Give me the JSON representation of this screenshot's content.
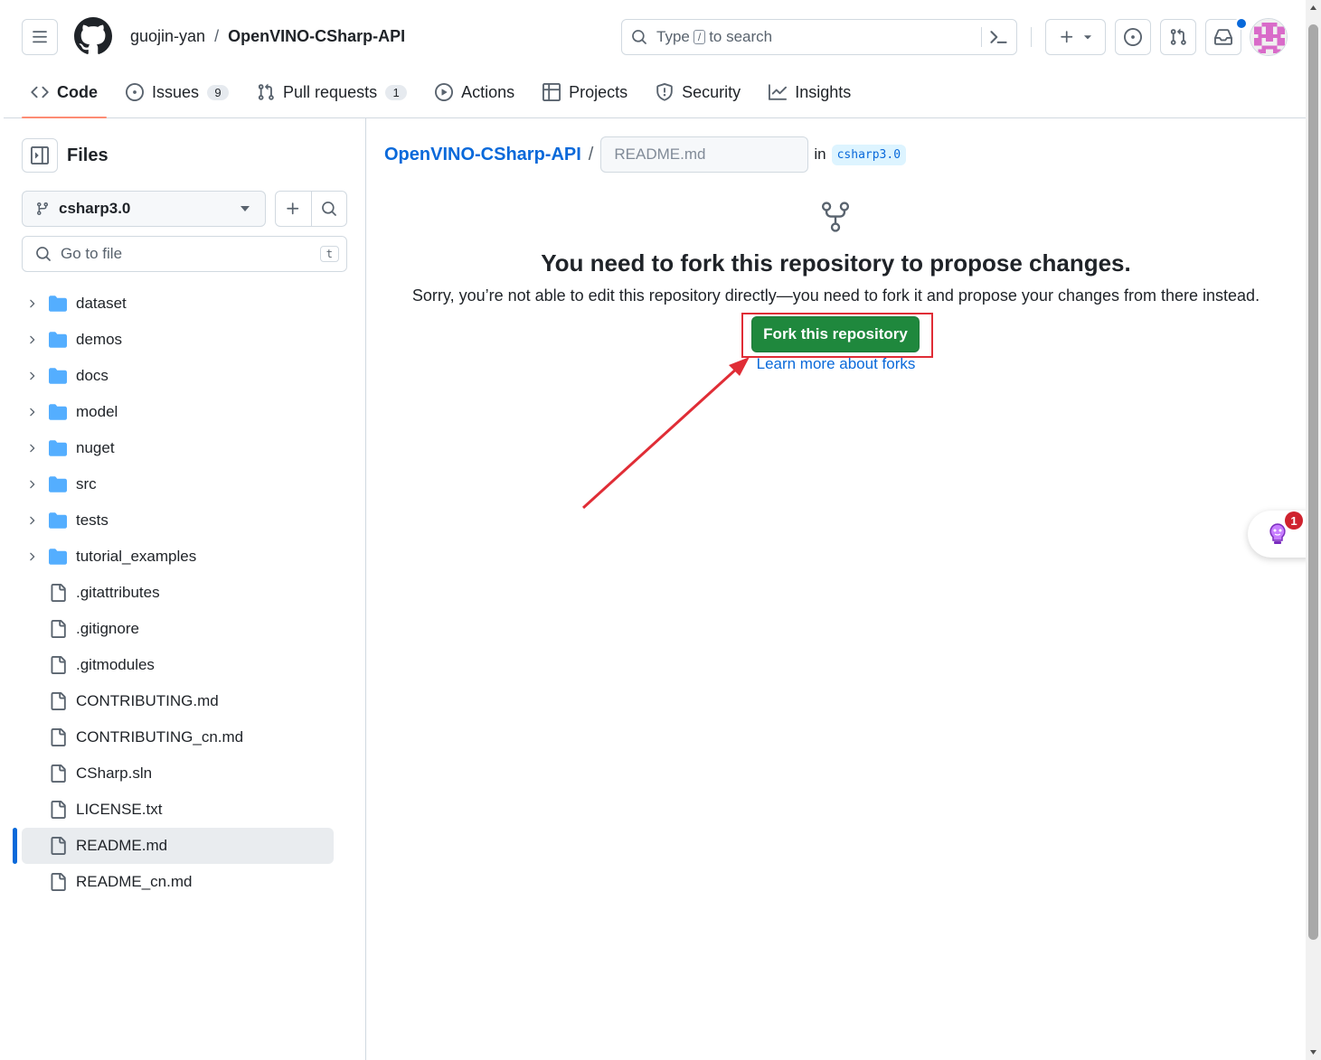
{
  "header": {
    "owner": "guojin-yan",
    "separator": "/",
    "repo": "OpenVINO-CSharp-API",
    "search_prefix": "Type",
    "search_key": "/",
    "search_suffix": "to search"
  },
  "tabs": [
    {
      "label": "Code",
      "icon": "code-icon",
      "active": true
    },
    {
      "label": "Issues",
      "icon": "issue-icon",
      "count": "9"
    },
    {
      "label": "Pull requests",
      "icon": "pull-request-icon",
      "count": "1"
    },
    {
      "label": "Actions",
      "icon": "play-icon"
    },
    {
      "label": "Projects",
      "icon": "table-icon"
    },
    {
      "label": "Security",
      "icon": "shield-icon"
    },
    {
      "label": "Insights",
      "icon": "graph-icon"
    }
  ],
  "sidebar": {
    "title": "Files",
    "branch": "csharp3.0",
    "goto_placeholder": "Go to file",
    "goto_shortcut": "t",
    "items": [
      {
        "label": "dataset",
        "type": "folder"
      },
      {
        "label": "demos",
        "type": "folder"
      },
      {
        "label": "docs",
        "type": "folder"
      },
      {
        "label": "model",
        "type": "folder"
      },
      {
        "label": "nuget",
        "type": "folder"
      },
      {
        "label": "src",
        "type": "folder"
      },
      {
        "label": "tests",
        "type": "folder"
      },
      {
        "label": "tutorial_examples",
        "type": "folder"
      },
      {
        "label": ".gitattributes",
        "type": "file"
      },
      {
        "label": ".gitignore",
        "type": "file"
      },
      {
        "label": ".gitmodules",
        "type": "file"
      },
      {
        "label": "CONTRIBUTING.md",
        "type": "file"
      },
      {
        "label": "CONTRIBUTING_cn.md",
        "type": "file"
      },
      {
        "label": "CSharp.sln",
        "type": "file"
      },
      {
        "label": "LICENSE.txt",
        "type": "file"
      },
      {
        "label": "README.md",
        "type": "file",
        "selected": true
      },
      {
        "label": "README_cn.md",
        "type": "file"
      }
    ]
  },
  "main": {
    "path_repo": "OpenVINO-CSharp-API",
    "path_sep": "/",
    "filename_placeholder": "README.md",
    "in_label": "in",
    "branch_chip": "csharp3.0",
    "fork_title": "You need to fork this repository to propose changes.",
    "fork_desc": "Sorry, you’re not able to edit this repository directly—you need to fork it and propose your changes from there instead.",
    "fork_button": "Fork this repository",
    "learn_link": "Learn more about forks"
  },
  "floating": {
    "badge_count": "1"
  },
  "colors": {
    "accent_blue": "#0969da",
    "fork_green": "#1f883d",
    "annotation_red": "#e02d36",
    "tab_underline": "#fd8c73"
  }
}
